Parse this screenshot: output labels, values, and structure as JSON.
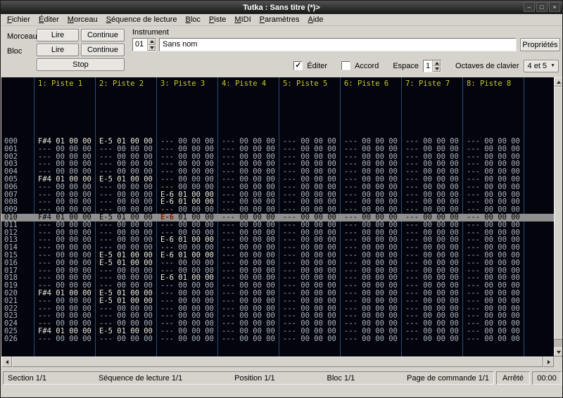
{
  "window": {
    "title": "Tutka : Sans titre (*)>"
  },
  "icons": {
    "minimize": "–",
    "maximize": "□",
    "close": "×",
    "check": "✓",
    "combo_arrow": "▼"
  },
  "menubar": {
    "items": [
      "Fichier",
      "Éditer",
      "Morceau",
      "Séquence de lecture",
      "Bloc",
      "Piste",
      "MIDI",
      "Paramètres",
      "Aide"
    ]
  },
  "toolbar": {
    "song_label": "Morceau",
    "block_label": "Bloc",
    "play_label": "Lire",
    "continue_label": "Continue",
    "stop_label": "Stop",
    "instrument_label": "Instrument",
    "instrument_number": "01",
    "instrument_name": "Sans nom",
    "properties_label": "Propriétés",
    "edit_label": "Éditer",
    "edit_checked": true,
    "chord_label": "Accord",
    "chord_checked": false,
    "space_label": "Espace",
    "space_value": "1",
    "octaves_label": "Octaves de clavier",
    "octaves_value": "4 et 5"
  },
  "tracker": {
    "empty_cell": "--- 00 00 00",
    "track_headers": [
      "1: Piste 1",
      "2: Piste 2",
      "3: Piste 3",
      "4: Piste 4",
      "5: Piste 5",
      "6: Piste 6",
      "7: Piste 7",
      "8: Piste 8"
    ],
    "current_row": 10,
    "cursor_track": 2,
    "rows": [
      {
        "num": "000",
        "notes": {
          "0": "F#4 01 00 00",
          "1": "E-5 01 00 00"
        }
      },
      {
        "num": "001",
        "notes": {}
      },
      {
        "num": "002",
        "notes": {}
      },
      {
        "num": "003",
        "notes": {}
      },
      {
        "num": "004",
        "notes": {}
      },
      {
        "num": "005",
        "notes": {
          "0": "F#4 01 00 00",
          "1": "E-5 01 00 00"
        }
      },
      {
        "num": "006",
        "notes": {}
      },
      {
        "num": "007",
        "notes": {
          "2": "E-6 01 00 00"
        }
      },
      {
        "num": "008",
        "notes": {
          "2": "E-6 01 00 00"
        }
      },
      {
        "num": "009",
        "notes": {}
      },
      {
        "num": "010",
        "notes": {
          "0": "F#4 01 00 00",
          "1": "E-5 01 00 00",
          "2": "E-6 01 00 00"
        }
      },
      {
        "num": "011",
        "notes": {}
      },
      {
        "num": "012",
        "notes": {}
      },
      {
        "num": "013",
        "notes": {
          "2": "E-6 01 00 00"
        }
      },
      {
        "num": "014",
        "notes": {}
      },
      {
        "num": "015",
        "notes": {
          "1": "E-5 01 00 00",
          "2": "E-6 01 00 00"
        }
      },
      {
        "num": "016",
        "notes": {
          "1": "E-5 01 00 00"
        }
      },
      {
        "num": "017",
        "notes": {}
      },
      {
        "num": "018",
        "notes": {
          "2": "E-6 01 00 00"
        }
      },
      {
        "num": "019",
        "notes": {}
      },
      {
        "num": "020",
        "notes": {
          "0": "F#4 01 00 00",
          "1": "E-5 01 00 00"
        }
      },
      {
        "num": "021",
        "notes": {
          "1": "E-5 01 00 00"
        }
      },
      {
        "num": "022",
        "notes": {}
      },
      {
        "num": "023",
        "notes": {}
      },
      {
        "num": "024",
        "notes": {}
      },
      {
        "num": "025",
        "notes": {
          "0": "F#4 01 00 00",
          "1": "E-5 01 00 00"
        }
      },
      {
        "num": "026",
        "notes": {}
      }
    ]
  },
  "statusbar": {
    "section": "Section 1/1",
    "sequence": "Séquence de lecture 1/1",
    "position": "Position 1/1",
    "block": "Bloc 1/1",
    "command_page": "Page de commande 1/1",
    "state": "Arrêté",
    "time": "00:00"
  },
  "colors": {
    "pattern_background": "#04040c",
    "track_separator": "#24507c",
    "track_header_text": "#c8c832",
    "current_row_background": "#8f8f8f",
    "cursor_text": "#8b1e00"
  }
}
